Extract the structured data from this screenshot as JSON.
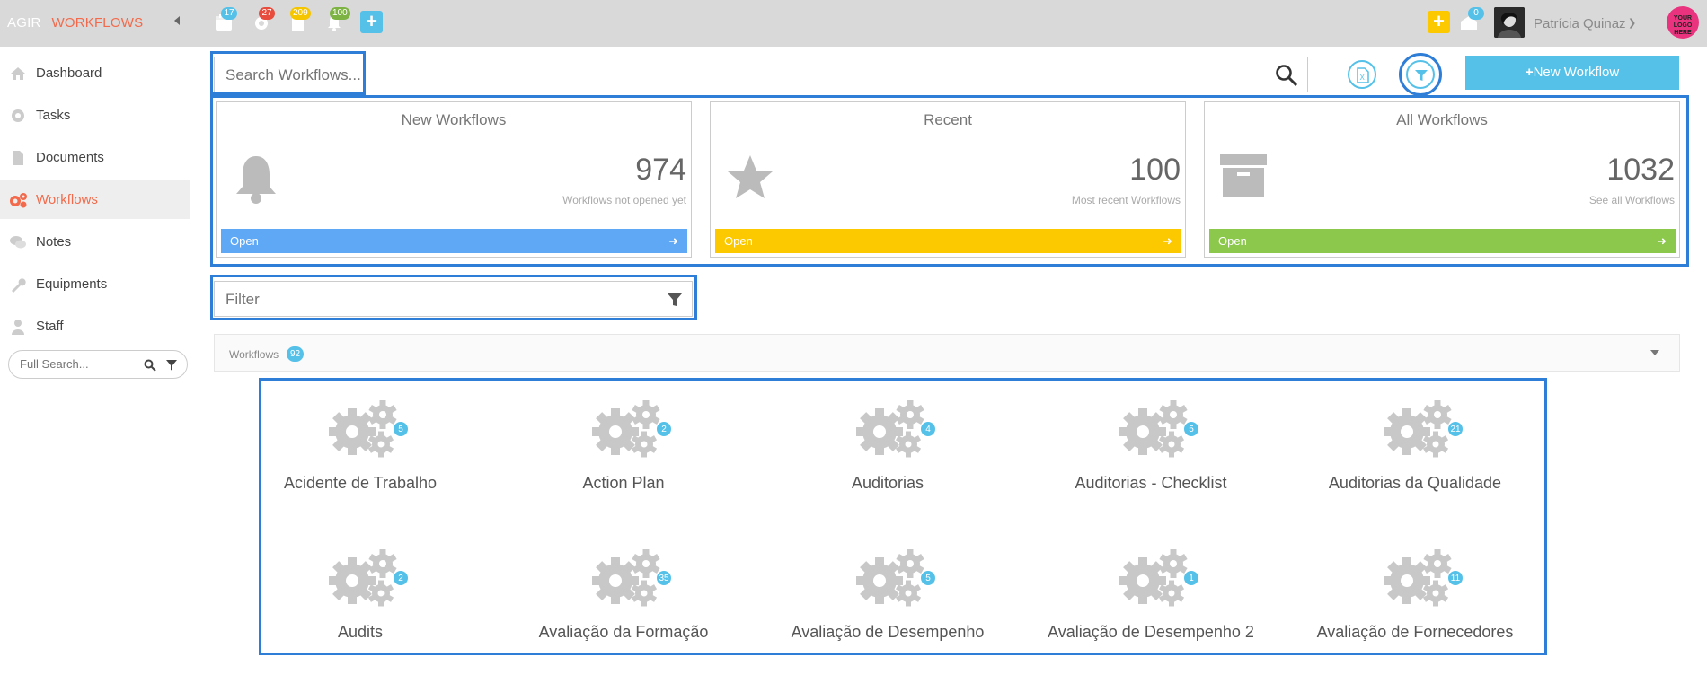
{
  "brand": {
    "company": "AGIR",
    "app": "WORKFLOWS"
  },
  "topbar": {
    "badges": [
      {
        "icon": "calendar-icon",
        "count": "17",
        "color": "#55c1e9"
      },
      {
        "icon": "gear-icon",
        "count": "27",
        "color": "#e74c3c"
      },
      {
        "icon": "document-icon",
        "count": "209",
        "color": "#f5c500"
      },
      {
        "icon": "bell-icon",
        "count": "100",
        "color": "#7cb342"
      }
    ],
    "mail_count": "0",
    "user_name": "Patrícia Quinaz",
    "logo_text": "YOUR LOGO HERE"
  },
  "sidebar": {
    "items": [
      {
        "label": "Dashboard",
        "icon": "home-icon"
      },
      {
        "label": "Tasks",
        "icon": "gear-icon"
      },
      {
        "label": "Documents",
        "icon": "document-icon"
      },
      {
        "label": "Workflows",
        "icon": "gears-icon",
        "active": true
      },
      {
        "label": "Notes",
        "icon": "chat-icon"
      },
      {
        "label": "Equipments",
        "icon": "wrench-icon"
      },
      {
        "label": "Staff",
        "icon": "user-icon"
      }
    ],
    "search_placeholder": "Full Search..."
  },
  "search": {
    "placeholder": "Search Workflows..."
  },
  "new_workflow_label": "New Workflow",
  "cards": [
    {
      "title": "New Workflows",
      "number": "974",
      "sub": "Workflows not opened yet",
      "open": "Open",
      "color": "#5ea8f5",
      "icon": "bell-icon"
    },
    {
      "title": "Recent",
      "number": "100",
      "sub": "Most recent Workflows",
      "open": "Open",
      "color": "#fcc800",
      "icon": "star-icon"
    },
    {
      "title": "All Workflows",
      "number": "1032",
      "sub": "See all Workflows",
      "open": "Open",
      "color": "#8cc84b",
      "icon": "archive-icon"
    }
  ],
  "filter": {
    "placeholder": "Filter"
  },
  "workflows_header": {
    "label": "Workflows",
    "count": "92"
  },
  "workflows": [
    {
      "name": "Acidente de Trabalho",
      "count": "5"
    },
    {
      "name": "Action Plan",
      "count": "2"
    },
    {
      "name": "Auditorias",
      "count": "4"
    },
    {
      "name": "Auditorias - Checklist",
      "count": "5"
    },
    {
      "name": "Auditorias da Qualidade",
      "count": "21"
    },
    {
      "name": "Audits",
      "count": "2"
    },
    {
      "name": "Avaliação da Formação",
      "count": "35"
    },
    {
      "name": "Avaliação de Desempenho",
      "count": "5"
    },
    {
      "name": "Avaliação de Desempenho 2",
      "count": "1"
    },
    {
      "name": "Avaliação de Fornecedores",
      "count": "11"
    }
  ],
  "colors": {
    "accent": "#55c1e9",
    "brand": "#f26a4b",
    "highlight": "#2e7dd6"
  }
}
